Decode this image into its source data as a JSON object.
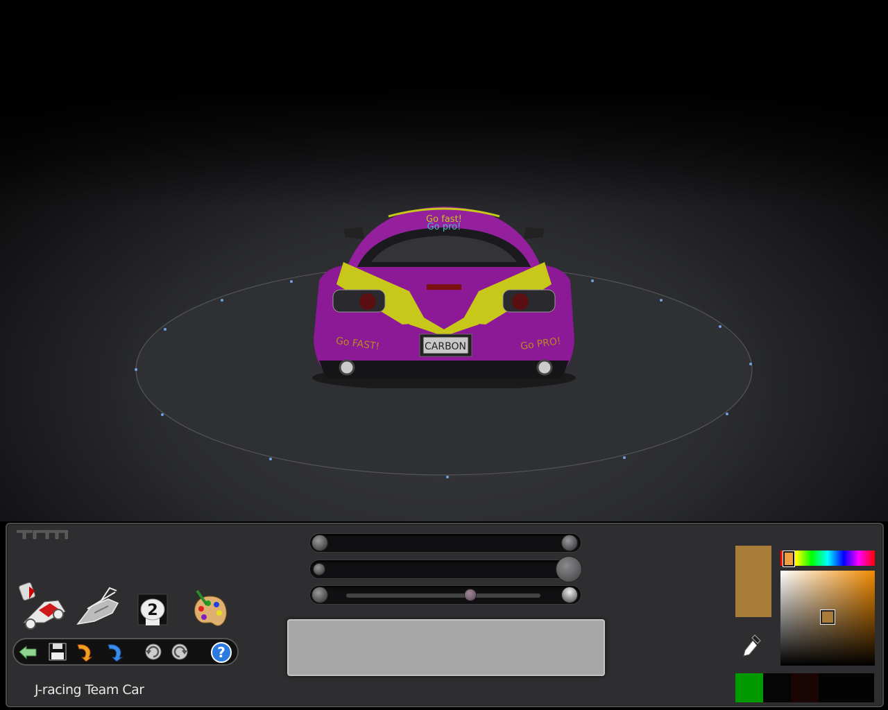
{
  "scene": {
    "license_plate": "CARBON",
    "livery_text": [
      "Go fast!",
      "Go pro!",
      "Go FAST!",
      "Go PRO!"
    ],
    "colors": {
      "body": "#8c1a96",
      "stripe": "#c8c81a"
    }
  },
  "panel": {
    "logo": "TM",
    "car_name": "J-racing Team Car",
    "tools": [
      {
        "name": "paint-car-tool",
        "icon": "car-paint-icon"
      },
      {
        "name": "model-tool",
        "icon": "car-wireframe-icon"
      },
      {
        "name": "number-tool",
        "icon": "race-number-icon",
        "label": "2"
      },
      {
        "name": "palette-tool",
        "icon": "paint-palette-icon"
      }
    ],
    "toolbar": [
      {
        "name": "back-button",
        "icon": "back-arrow-icon"
      },
      {
        "name": "save-button",
        "icon": "floppy-disk-icon"
      },
      {
        "name": "undo-button",
        "icon": "undo-arrow-icon"
      },
      {
        "name": "redo-button",
        "icon": "redo-arrow-icon"
      },
      {
        "name": "rotate-left-button",
        "icon": "rotate-left-icon"
      },
      {
        "name": "rotate-right-button",
        "icon": "rotate-right-icon"
      },
      {
        "name": "help-button",
        "icon": "question-mark-icon",
        "label": "?"
      }
    ],
    "text_input": {
      "value": ""
    },
    "color": {
      "selected": "#a97c3a",
      "hue_base": "#f08a00",
      "palette": [
        "#009900",
        "#050505",
        "#1a0505",
        "#030303",
        "#030303"
      ]
    }
  }
}
